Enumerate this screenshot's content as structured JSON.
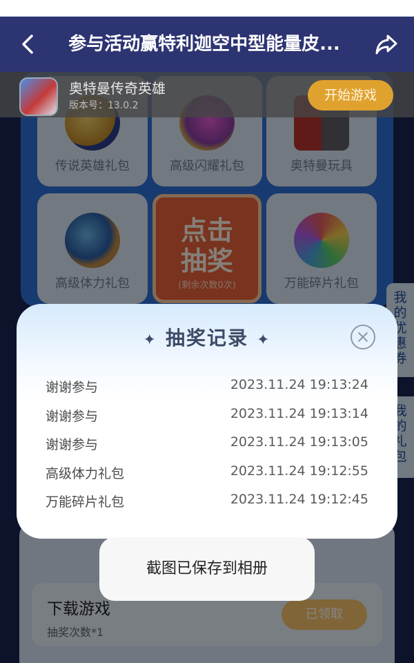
{
  "nav": {
    "title": "参与活动赢特利迦空中型能量皮...",
    "back_icon": "back-chevron-icon",
    "share_icon": "share-arrow-icon"
  },
  "game": {
    "name": "奥特曼传奇英雄",
    "version": "版本号：13.0.2",
    "start_label": "开始游戏"
  },
  "prizes": [
    {
      "label": "传说英雄礼包"
    },
    {
      "label": "高级闪耀礼包"
    },
    {
      "label": "奥特曼玩具"
    },
    {
      "label": "高级体力礼包"
    },
    {
      "label": "万能碎片礼包"
    }
  ],
  "draw": {
    "label": "点击\n抽奖",
    "line1": "点击",
    "line2": "抽奖",
    "remaining": "(剩余次数0次)"
  },
  "side_tabs": {
    "coupons": "我的优惠券",
    "gifts": "我的礼包"
  },
  "modal": {
    "title": "抽奖记录",
    "close_icon": "close-circle-icon",
    "records": [
      {
        "prize": "谢谢参与",
        "time": "2023.11.24 19:13:24"
      },
      {
        "prize": "谢谢参与",
        "time": "2023.11.24 19:13:14"
      },
      {
        "prize": "谢谢参与",
        "time": "2023.11.24 19:13:05"
      },
      {
        "prize": "高级体力礼包",
        "time": "2023.11.24 19:12:55"
      },
      {
        "prize": "万能碎片礼包",
        "time": "2023.11.24 19:12:45"
      }
    ]
  },
  "task": {
    "title": "下载游戏",
    "subtitle": "抽奖次数*1",
    "button": "已领取"
  },
  "toast": {
    "message": "截图已保存到相册"
  },
  "colors": {
    "nav_bg": "#2c3472",
    "accent_orange": "#e0a22f",
    "draw_red": "#e9623b",
    "panel_blue": "#2d6fd6"
  }
}
